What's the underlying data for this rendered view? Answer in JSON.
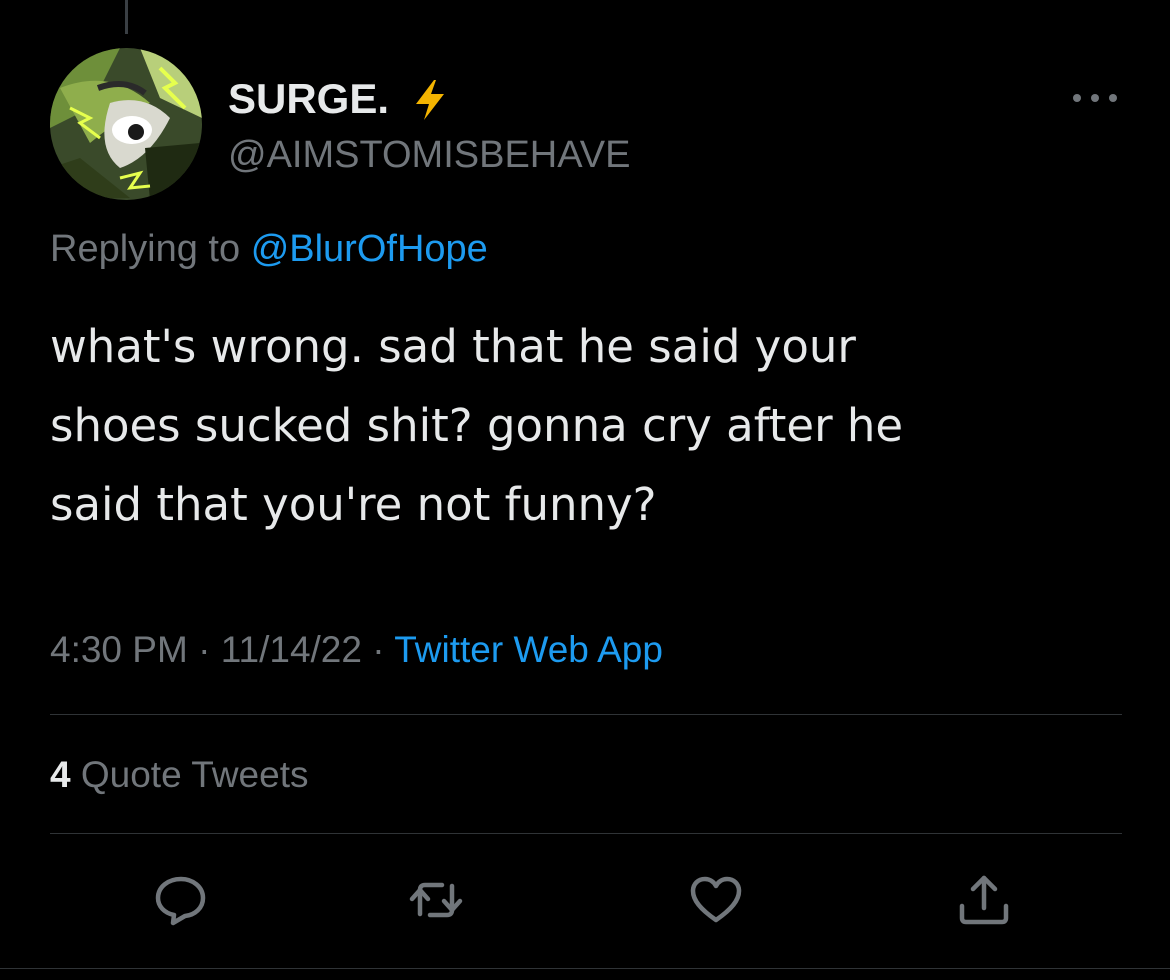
{
  "tweet": {
    "author": {
      "display_name": "SURGE.",
      "handle": "@AIMSTOMISBEHAVE",
      "name_emoji": "lightning-bolt"
    },
    "replying_to": {
      "prefix": "Replying to",
      "mention": "@BlurOfHope"
    },
    "text": "what's wrong. sad that he said your\nshoes sucked shit? gonna cry after he\nsaid that you're not funny?",
    "time": "4:30 PM",
    "separator": "·",
    "date": "11/14/22",
    "source": "Twitter Web App",
    "stats": {
      "quote_tweets_count": "4",
      "quote_tweets_label": "Quote Tweets"
    },
    "actions": [
      {
        "name": "reply",
        "icon": "reply-icon"
      },
      {
        "name": "retweet",
        "icon": "retweet-icon"
      },
      {
        "name": "like",
        "icon": "heart-icon"
      },
      {
        "name": "share",
        "icon": "share-icon"
      }
    ]
  },
  "theme": {
    "background": "#000000",
    "text_primary": "#e7e9ea",
    "text_secondary": "#71767b",
    "accent": "#1d9bf0",
    "divider": "#2f3336",
    "bolt": "#f4b400"
  }
}
